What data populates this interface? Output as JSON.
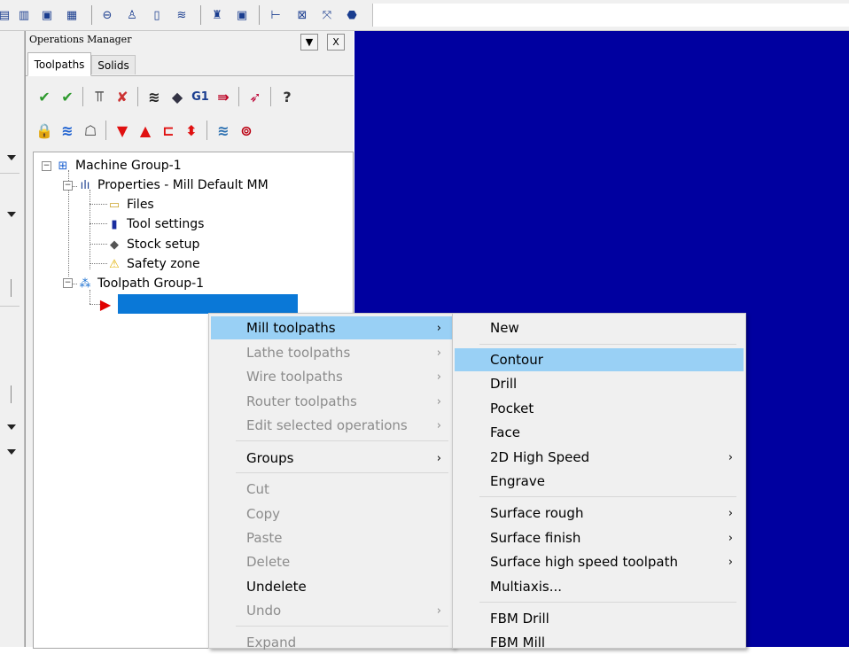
{
  "top_toolbar": {
    "icons": [
      "toolbar-icon-1",
      "toolbar-icon-2",
      "toolbar-icon-3",
      "toolbar-icon-4",
      "toolbar-icon-5",
      "toolbar-icon-6",
      "toolbar-icon-7",
      "toolbar-icon-8",
      "toolbar-icon-9",
      "toolbar-icon-10",
      "toolbar-icon-11",
      "toolbar-icon-12",
      "toolbar-icon-13",
      "toolbar-icon-14"
    ]
  },
  "panel": {
    "title": "Operations Manager",
    "dropdown_glyph": "▼",
    "close_glyph": "X",
    "tabs": [
      {
        "label": "Toolpaths",
        "active": true
      },
      {
        "label": "Solids",
        "active": false
      }
    ],
    "g1_label": "G1"
  },
  "tree": {
    "machine_group": "Machine Group-1",
    "properties": "Properties - Mill Default MM",
    "files": "Files",
    "tool_settings": "Tool settings",
    "stock_setup": "Stock setup",
    "safety_zone": "Safety zone",
    "toolpath_group": "Toolpath Group-1",
    "new_op_selected": ""
  },
  "context_menu": {
    "items": [
      {
        "label": "Mill toolpaths",
        "submenu": true,
        "disabled": false,
        "highlighted": true
      },
      {
        "label": "Lathe toolpaths",
        "submenu": true,
        "disabled": true
      },
      {
        "label": "Wire toolpaths",
        "submenu": true,
        "disabled": true
      },
      {
        "label": "Router toolpaths",
        "submenu": true,
        "disabled": true
      },
      {
        "label": "Edit selected operations",
        "submenu": true,
        "disabled": true
      },
      {
        "label": "Groups",
        "submenu": true,
        "disabled": false
      },
      {
        "label": "Cut",
        "disabled": true
      },
      {
        "label": "Copy",
        "disabled": true
      },
      {
        "label": "Paste",
        "disabled": true
      },
      {
        "label": "Delete",
        "disabled": true
      },
      {
        "label": "Undelete",
        "disabled": false
      },
      {
        "label": "Undo",
        "submenu": true,
        "disabled": true
      },
      {
        "label": "Expand",
        "disabled": true
      }
    ],
    "arrow_glyph": "›"
  },
  "submenu": {
    "items": [
      {
        "label": "New"
      },
      {
        "label": "Contour",
        "highlighted": true
      },
      {
        "label": "Drill"
      },
      {
        "label": "Pocket"
      },
      {
        "label": "Face"
      },
      {
        "label": "2D High Speed",
        "submenu": true
      },
      {
        "label": "Engrave"
      },
      {
        "label": "Surface rough",
        "submenu": true
      },
      {
        "label": "Surface finish",
        "submenu": true
      },
      {
        "label": "Surface high speed toolpath",
        "submenu": true
      },
      {
        "label": "Multiaxis..."
      },
      {
        "label": "FBM Drill"
      },
      {
        "label": "FBM Mill"
      }
    ]
  },
  "colors": {
    "viewport": "#0000a0",
    "highlight": "#99d0f5",
    "selection": "#0a78d7",
    "disabled_text": "#8c8c8c"
  }
}
